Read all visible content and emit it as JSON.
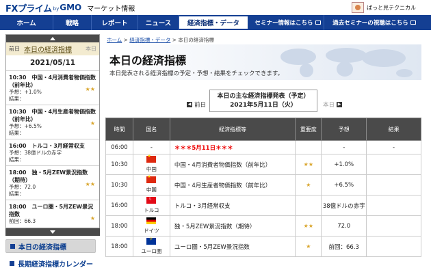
{
  "header": {
    "brand_fx": "FXプライム",
    "brand_by": "by",
    "brand_gmo": "GMO",
    "brand_sub": "マーケット情報",
    "user_link": "ぱっと見テクニカル"
  },
  "nav": {
    "items": [
      {
        "label": "ホーム"
      },
      {
        "label": "戦略"
      },
      {
        "label": "レポート"
      },
      {
        "label": "ニュース"
      },
      {
        "label": "経済指標・データ"
      },
      {
        "label": "セミナー情報はこちら"
      },
      {
        "label": "過去セミナーの視聴はこちら"
      }
    ]
  },
  "sidebar": {
    "prev": "前日",
    "title": "本日の経済指標",
    "next": "本日",
    "date": "2021/05/11",
    "events": [
      {
        "head": "10:30　中国・4月消費者物価指数（前年比）",
        "l1": "予想：+1.0%",
        "l2": "結果：",
        "stars": "★★"
      },
      {
        "head": "10:30　中国・4月生産者物価指数（前年比）",
        "l1": "予想：+6.5%",
        "l2": "結果：",
        "stars": "★"
      },
      {
        "head": "16:00　トルコ・3月経常収支",
        "l1": "予想：38億ドルの赤字",
        "l2": "結果：",
        "stars": ""
      },
      {
        "head": "18:00　独・5月ZEW景況指数（期待）",
        "l1": "予想：72.0",
        "l2": "結果：",
        "stars": "★★"
      },
      {
        "head": "18:00　ユーロ圏・5月ZEW景況指数",
        "l1": "前回：66.3",
        "l2": "",
        "stars": "★"
      }
    ],
    "menu_active": "本日の経済指標",
    "menu_next": "長期経済指標カレンダー"
  },
  "breadcrumb": {
    "home": "ホーム",
    "sep1": " > ",
    "section": "経済指標・データ",
    "sep2": " > ",
    "current": "本日の経済指標"
  },
  "hero": {
    "title": "本日の経済指標",
    "desc": "本日発表される経済指標の予定・予想・結果をチェックできます。"
  },
  "daynav": {
    "prev": "前日",
    "next": "本日",
    "box_line1": "本日の主な経済指標発表（予定）",
    "box_line2": "2021年5月11日（火）"
  },
  "table": {
    "headers": {
      "time": "時間",
      "country": "国名",
      "indicator": "経済指標等",
      "importance": "重要度",
      "forecast": "予想",
      "result": "結果"
    },
    "rows": [
      {
        "time": "06:00",
        "country": "-",
        "indicator": "＊＊＊5月11日＊＊＊",
        "stars": "",
        "forecast": "-",
        "result": "-"
      },
      {
        "time": "10:30",
        "country": "中国",
        "indicator": "中国・4月消費者物価指数（前年比）",
        "stars": "★★",
        "forecast": "+1.0%",
        "result": ""
      },
      {
        "time": "10:30",
        "country": "中国",
        "indicator": "中国・4月生産者物価指数（前年比）",
        "stars": "★",
        "forecast": "+6.5%",
        "result": ""
      },
      {
        "time": "16:00",
        "country": "トルコ",
        "indicator": "トルコ・3月経常収支",
        "stars": "",
        "forecast": "38億ドルの赤字",
        "result": ""
      },
      {
        "time": "18:00",
        "country": "ドイツ",
        "indicator": "独・5月ZEW景況指数（期待）",
        "stars": "★★",
        "forecast": "72.0",
        "result": ""
      },
      {
        "time": "18:00",
        "country": "ユーロ圏",
        "indicator": "ユーロ圏・5月ZEW景況指数",
        "stars": "★",
        "forecast": "前回：66.3",
        "result": ""
      }
    ]
  }
}
